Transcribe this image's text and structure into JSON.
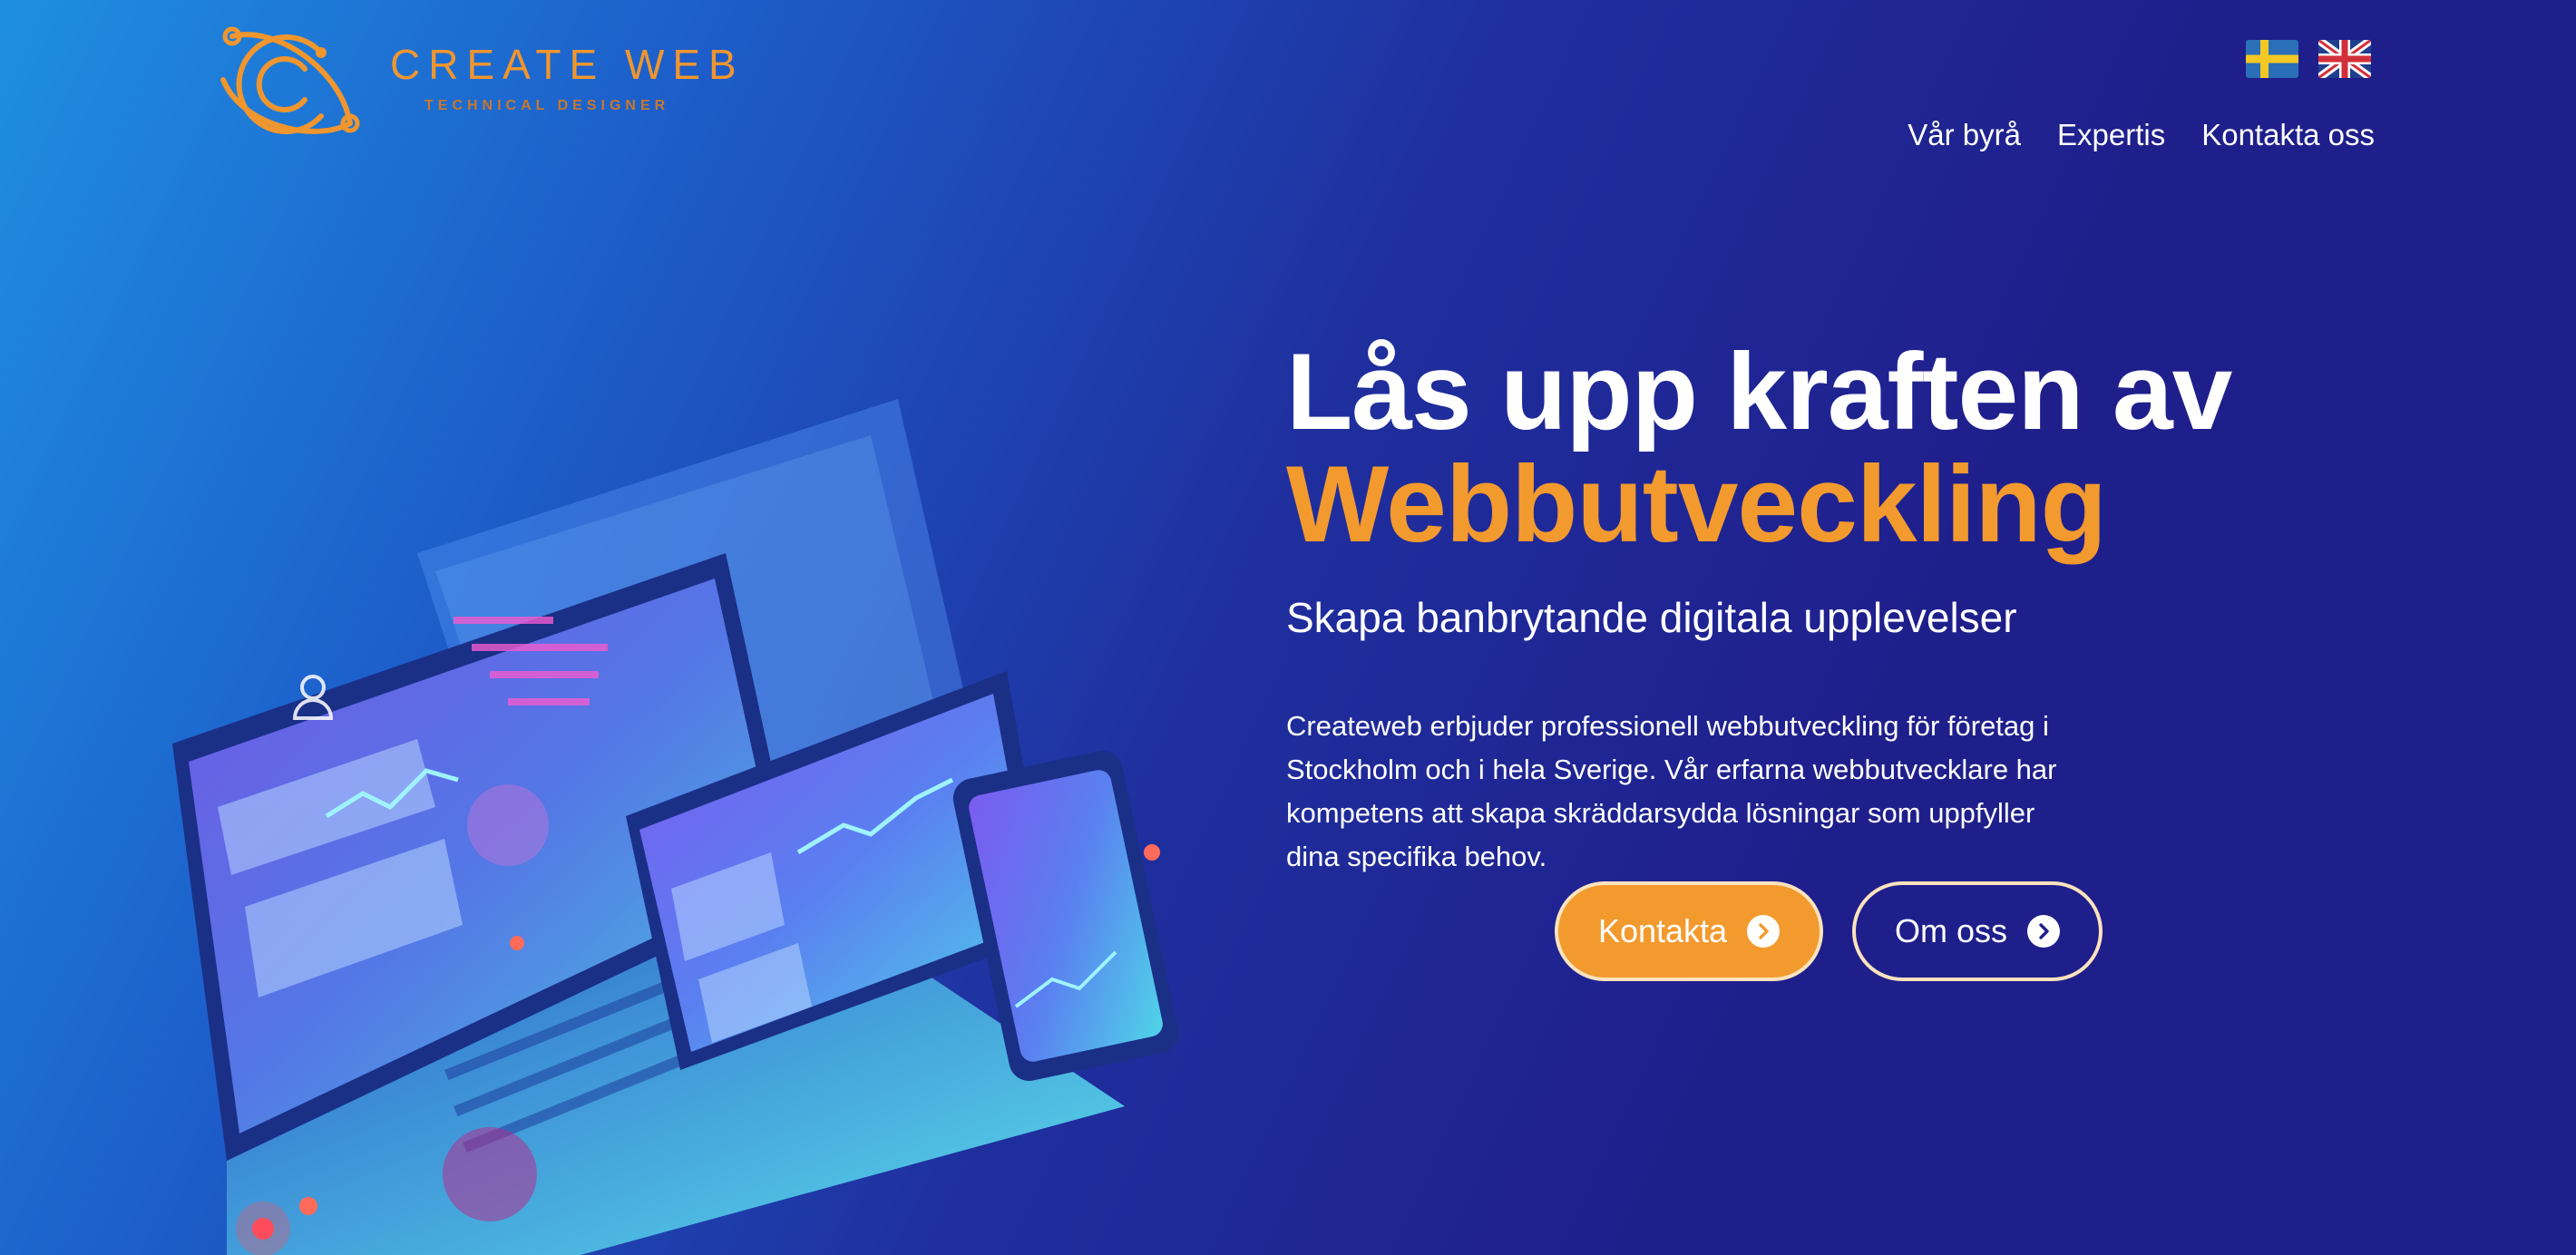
{
  "brand": {
    "name": "CREATE WEB",
    "tagline": "TECHNICAL DESIGNER",
    "color": "#f0962e",
    "icon": "orbit-c-logo-icon"
  },
  "languages": [
    {
      "code": "sv",
      "icon": "sweden-flag-icon"
    },
    {
      "code": "en",
      "icon": "uk-flag-icon"
    }
  ],
  "nav": {
    "items": [
      {
        "label": "Vår byrå"
      },
      {
        "label": "Expertis"
      },
      {
        "label": "Kontakta oss"
      }
    ]
  },
  "hero": {
    "title_line1": "Lås upp kraften av",
    "title_line2": "Webbutveckling",
    "accent_color": "#f39a2e",
    "subtitle": "Skapa banbrytande digitala upplevelser",
    "description": "Createweb erbjuder professionell webbutveckling för företag i Stockholm och i hela Sverige. Vår erfarna webbutvecklare har kompetens att skapa skräddarsydda lösningar som uppfyller dina specifika behov.",
    "illustration": "devices-web-development-illustration",
    "buttons": {
      "primary_label": "Kontakta",
      "secondary_label": "Om oss",
      "icon": "chevron-right-circle-icon"
    }
  }
}
